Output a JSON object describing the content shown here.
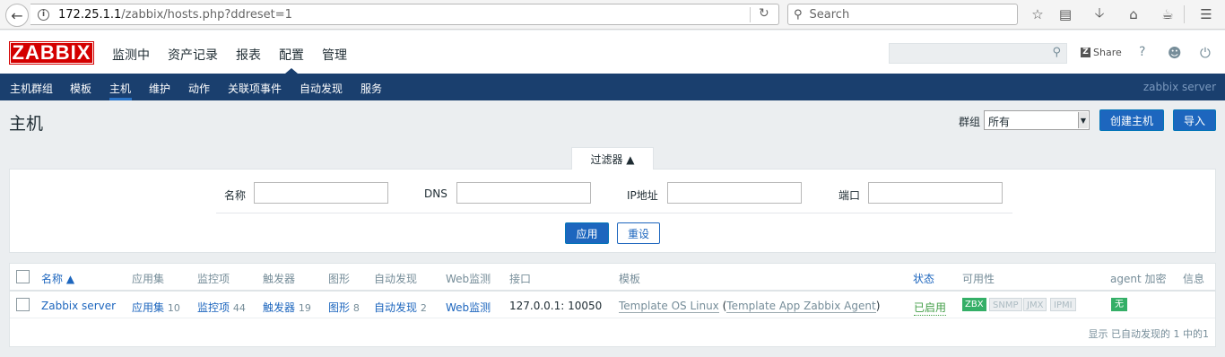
{
  "browser": {
    "url_host": "172.25.1.1",
    "url_path": "/zabbix/hosts.php?ddreset=1",
    "search_placeholder": "Search"
  },
  "header": {
    "logo": "ZABBIX",
    "menu": [
      "监测中",
      "资产记录",
      "报表",
      "配置",
      "管理"
    ],
    "active_menu": "配置",
    "share_label": "Share",
    "help": "?"
  },
  "subnav": {
    "items": [
      "主机群组",
      "模板",
      "主机",
      "维护",
      "动作",
      "关联项事件",
      "自动发现",
      "服务"
    ],
    "active": "主机",
    "server_name": "zabbix server"
  },
  "page": {
    "title": "主机",
    "group_label": "群组",
    "group_value": "所有",
    "create_button": "创建主机",
    "import_button": "导入"
  },
  "filter": {
    "tab_label": "过滤器 ▲",
    "labels": {
      "name": "名称",
      "dns": "DNS",
      "ip": "IP地址",
      "port": "端口"
    },
    "values": {
      "name": "",
      "dns": "",
      "ip": "",
      "port": ""
    },
    "apply": "应用",
    "reset": "重设"
  },
  "table": {
    "headers": {
      "name": "名称 ▲",
      "applications": "应用集",
      "items": "监控项",
      "triggers": "触发器",
      "graphs": "图形",
      "discovery": "自动发现",
      "web": "Web监测",
      "interface": "接口",
      "templates": "模板",
      "status": "状态",
      "availability": "可用性",
      "encryption": "agent 加密",
      "info": "信息"
    },
    "rows": [
      {
        "name": "Zabbix server",
        "applications": {
          "label": "应用集",
          "count": "10"
        },
        "items": {
          "label": "监控项",
          "count": "44"
        },
        "triggers": {
          "label": "触发器",
          "count": "19"
        },
        "graphs": {
          "label": "图形",
          "count": "8"
        },
        "discovery": {
          "label": "自动发现",
          "count": "2"
        },
        "web": "Web监测",
        "interface": "127.0.0.1: 10050",
        "template_main": "Template OS Linux",
        "template_paren_open": " (",
        "template_sub": "Template App Zabbix Agent",
        "template_paren_close": ")",
        "status": "已启用",
        "availability": {
          "zbx": "ZBX",
          "snmp": "SNMP",
          "jmx": "JMX",
          "ipmi": "IPMI"
        },
        "encryption": "无"
      }
    ],
    "footer": "显示 已自动发现的 1 中的1"
  },
  "colors": {
    "brand_red": "#d40000",
    "subnav_bg": "#1a3f6e",
    "link_blue": "#1d66be",
    "status_green": "#429e47",
    "badge_green": "#34af67"
  }
}
